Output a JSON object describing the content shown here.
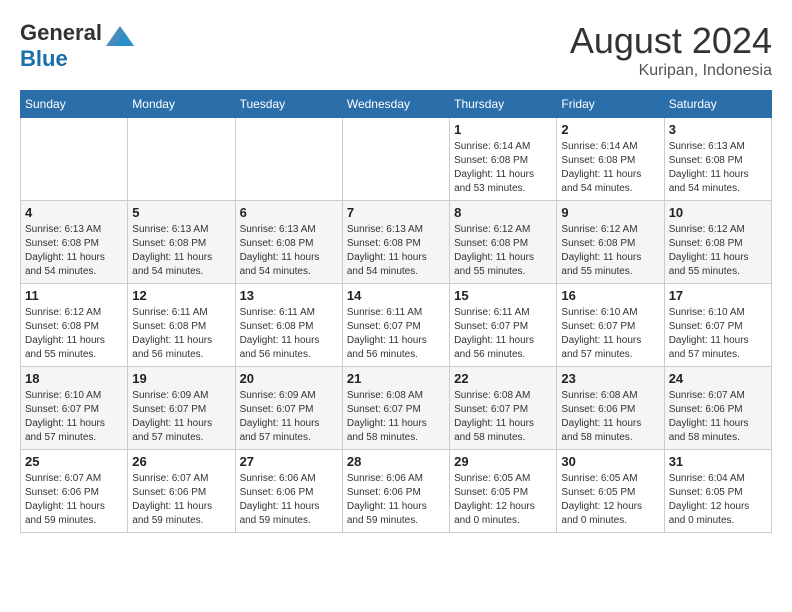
{
  "header": {
    "logo_general": "General",
    "logo_blue": "Blue",
    "month_year": "August 2024",
    "location": "Kuripan, Indonesia"
  },
  "weekdays": [
    "Sunday",
    "Monday",
    "Tuesday",
    "Wednesday",
    "Thursday",
    "Friday",
    "Saturday"
  ],
  "weeks": [
    [
      {
        "day": "",
        "sunrise": "",
        "sunset": "",
        "daylight": ""
      },
      {
        "day": "",
        "sunrise": "",
        "sunset": "",
        "daylight": ""
      },
      {
        "day": "",
        "sunrise": "",
        "sunset": "",
        "daylight": ""
      },
      {
        "day": "",
        "sunrise": "",
        "sunset": "",
        "daylight": ""
      },
      {
        "day": "1",
        "sunrise": "Sunrise: 6:14 AM",
        "sunset": "Sunset: 6:08 PM",
        "daylight": "Daylight: 11 hours and 53 minutes."
      },
      {
        "day": "2",
        "sunrise": "Sunrise: 6:14 AM",
        "sunset": "Sunset: 6:08 PM",
        "daylight": "Daylight: 11 hours and 54 minutes."
      },
      {
        "day": "3",
        "sunrise": "Sunrise: 6:13 AM",
        "sunset": "Sunset: 6:08 PM",
        "daylight": "Daylight: 11 hours and 54 minutes."
      }
    ],
    [
      {
        "day": "4",
        "sunrise": "Sunrise: 6:13 AM",
        "sunset": "Sunset: 6:08 PM",
        "daylight": "Daylight: 11 hours and 54 minutes."
      },
      {
        "day": "5",
        "sunrise": "Sunrise: 6:13 AM",
        "sunset": "Sunset: 6:08 PM",
        "daylight": "Daylight: 11 hours and 54 minutes."
      },
      {
        "day": "6",
        "sunrise": "Sunrise: 6:13 AM",
        "sunset": "Sunset: 6:08 PM",
        "daylight": "Daylight: 11 hours and 54 minutes."
      },
      {
        "day": "7",
        "sunrise": "Sunrise: 6:13 AM",
        "sunset": "Sunset: 6:08 PM",
        "daylight": "Daylight: 11 hours and 54 minutes."
      },
      {
        "day": "8",
        "sunrise": "Sunrise: 6:12 AM",
        "sunset": "Sunset: 6:08 PM",
        "daylight": "Daylight: 11 hours and 55 minutes."
      },
      {
        "day": "9",
        "sunrise": "Sunrise: 6:12 AM",
        "sunset": "Sunset: 6:08 PM",
        "daylight": "Daylight: 11 hours and 55 minutes."
      },
      {
        "day": "10",
        "sunrise": "Sunrise: 6:12 AM",
        "sunset": "Sunset: 6:08 PM",
        "daylight": "Daylight: 11 hours and 55 minutes."
      }
    ],
    [
      {
        "day": "11",
        "sunrise": "Sunrise: 6:12 AM",
        "sunset": "Sunset: 6:08 PM",
        "daylight": "Daylight: 11 hours and 55 minutes."
      },
      {
        "day": "12",
        "sunrise": "Sunrise: 6:11 AM",
        "sunset": "Sunset: 6:08 PM",
        "daylight": "Daylight: 11 hours and 56 minutes."
      },
      {
        "day": "13",
        "sunrise": "Sunrise: 6:11 AM",
        "sunset": "Sunset: 6:08 PM",
        "daylight": "Daylight: 11 hours and 56 minutes."
      },
      {
        "day": "14",
        "sunrise": "Sunrise: 6:11 AM",
        "sunset": "Sunset: 6:07 PM",
        "daylight": "Daylight: 11 hours and 56 minutes."
      },
      {
        "day": "15",
        "sunrise": "Sunrise: 6:11 AM",
        "sunset": "Sunset: 6:07 PM",
        "daylight": "Daylight: 11 hours and 56 minutes."
      },
      {
        "day": "16",
        "sunrise": "Sunrise: 6:10 AM",
        "sunset": "Sunset: 6:07 PM",
        "daylight": "Daylight: 11 hours and 57 minutes."
      },
      {
        "day": "17",
        "sunrise": "Sunrise: 6:10 AM",
        "sunset": "Sunset: 6:07 PM",
        "daylight": "Daylight: 11 hours and 57 minutes."
      }
    ],
    [
      {
        "day": "18",
        "sunrise": "Sunrise: 6:10 AM",
        "sunset": "Sunset: 6:07 PM",
        "daylight": "Daylight: 11 hours and 57 minutes."
      },
      {
        "day": "19",
        "sunrise": "Sunrise: 6:09 AM",
        "sunset": "Sunset: 6:07 PM",
        "daylight": "Daylight: 11 hours and 57 minutes."
      },
      {
        "day": "20",
        "sunrise": "Sunrise: 6:09 AM",
        "sunset": "Sunset: 6:07 PM",
        "daylight": "Daylight: 11 hours and 57 minutes."
      },
      {
        "day": "21",
        "sunrise": "Sunrise: 6:08 AM",
        "sunset": "Sunset: 6:07 PM",
        "daylight": "Daylight: 11 hours and 58 minutes."
      },
      {
        "day": "22",
        "sunrise": "Sunrise: 6:08 AM",
        "sunset": "Sunset: 6:07 PM",
        "daylight": "Daylight: 11 hours and 58 minutes."
      },
      {
        "day": "23",
        "sunrise": "Sunrise: 6:08 AM",
        "sunset": "Sunset: 6:06 PM",
        "daylight": "Daylight: 11 hours and 58 minutes."
      },
      {
        "day": "24",
        "sunrise": "Sunrise: 6:07 AM",
        "sunset": "Sunset: 6:06 PM",
        "daylight": "Daylight: 11 hours and 58 minutes."
      }
    ],
    [
      {
        "day": "25",
        "sunrise": "Sunrise: 6:07 AM",
        "sunset": "Sunset: 6:06 PM",
        "daylight": "Daylight: 11 hours and 59 minutes."
      },
      {
        "day": "26",
        "sunrise": "Sunrise: 6:07 AM",
        "sunset": "Sunset: 6:06 PM",
        "daylight": "Daylight: 11 hours and 59 minutes."
      },
      {
        "day": "27",
        "sunrise": "Sunrise: 6:06 AM",
        "sunset": "Sunset: 6:06 PM",
        "daylight": "Daylight: 11 hours and 59 minutes."
      },
      {
        "day": "28",
        "sunrise": "Sunrise: 6:06 AM",
        "sunset": "Sunset: 6:06 PM",
        "daylight": "Daylight: 11 hours and 59 minutes."
      },
      {
        "day": "29",
        "sunrise": "Sunrise: 6:05 AM",
        "sunset": "Sunset: 6:05 PM",
        "daylight": "Daylight: 12 hours and 0 minutes."
      },
      {
        "day": "30",
        "sunrise": "Sunrise: 6:05 AM",
        "sunset": "Sunset: 6:05 PM",
        "daylight": "Daylight: 12 hours and 0 minutes."
      },
      {
        "day": "31",
        "sunrise": "Sunrise: 6:04 AM",
        "sunset": "Sunset: 6:05 PM",
        "daylight": "Daylight: 12 hours and 0 minutes."
      }
    ]
  ]
}
